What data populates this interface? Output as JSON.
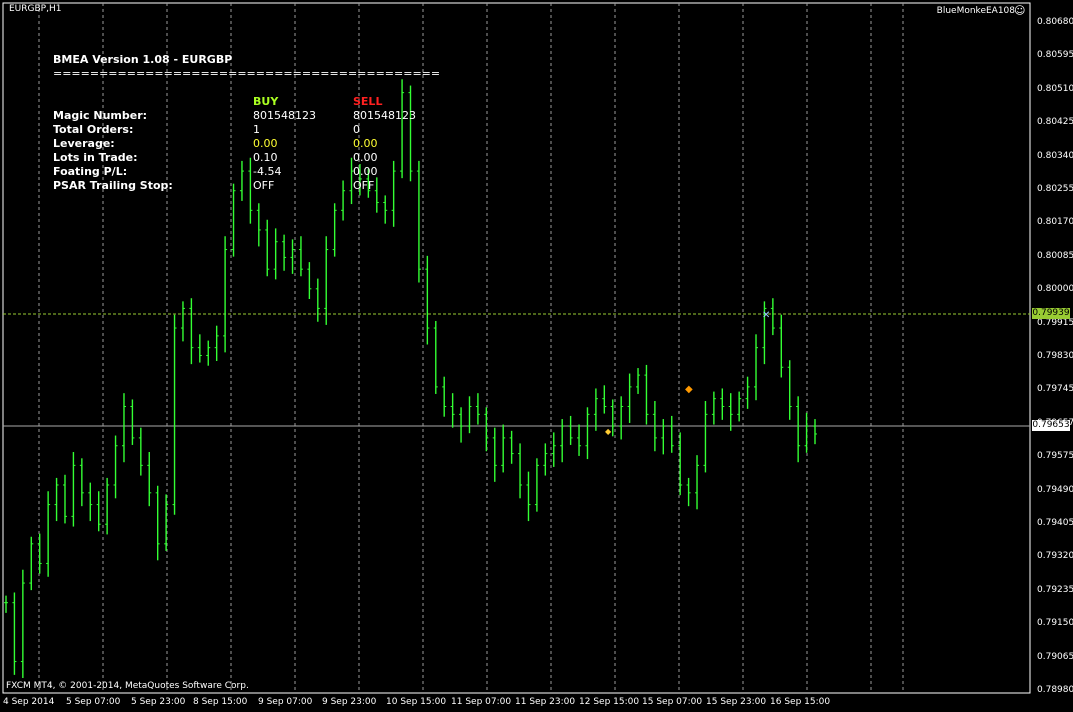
{
  "window": {
    "symbol": "EURGBP,H1",
    "ea_name": "BlueMonkeEA108",
    "copyright": "FXCM MT4, © 2001-2014, MetaQuotes Software Corp."
  },
  "colors": {
    "background": "#000000",
    "candle": "#33ff33",
    "grid": "#9a9a9a",
    "bid_line": "#aaaaaa",
    "ask_line": "#99cc33",
    "buy": "#aaff22",
    "sell": "#ff2020",
    "highlight": "#ffff33"
  },
  "hud": {
    "title": "BMEA Version 1.08 - EURGBP",
    "separator": "==========================================",
    "buy_header": "BUY",
    "sell_header": "SELL",
    "rows": [
      {
        "label": "Magic Number:",
        "buy": "801548123",
        "sell": "801548123"
      },
      {
        "label": "Total Orders:",
        "buy": "1",
        "sell": "0"
      },
      {
        "label": "Leverage:",
        "buy": "0.00",
        "sell": "0.00"
      },
      {
        "label": "Lots in Trade:",
        "buy": "0.10",
        "sell": "0.00"
      },
      {
        "label": "Foating P/L:",
        "buy": "-4.54",
        "sell": "0.00"
      },
      {
        "label": "PSAR Trailing Stop:",
        "buy": "OFF",
        "sell": "OFF"
      }
    ]
  },
  "price_axis": {
    "ticks": [
      "0.80680",
      "0.80595",
      "0.80510",
      "0.80425",
      "0.80340",
      "0.80255",
      "0.80170",
      "0.80085",
      "0.80000",
      "0.79915",
      "0.79830",
      "0.79745",
      "0.79657",
      "0.79575",
      "0.79490",
      "0.79405",
      "0.79320",
      "0.79235",
      "0.79150",
      "0.79065",
      "0.78980"
    ],
    "ask_price": "0.79939",
    "bid_price": "0.79653"
  },
  "time_axis": {
    "ticks": [
      "4 Sep 2014",
      "5 Sep 07:00",
      "5 Sep 23:00",
      "8 Sep 15:00",
      "9 Sep 07:00",
      "9 Sep 23:00",
      "10 Sep 15:00",
      "11 Sep 07:00",
      "11 Sep 23:00",
      "12 Sep 15:00",
      "15 Sep 07:00",
      "15 Sep 23:00",
      "16 Sep 15:00"
    ]
  },
  "chart_data": {
    "type": "bar",
    "title": "",
    "ylim": [
      0.7898,
      0.8068
    ],
    "closes": [
      0.792,
      0.7905,
      0.7925,
      0.7935,
      0.793,
      0.7945,
      0.795,
      0.7942,
      0.7955,
      0.7948,
      0.7945,
      0.794,
      0.795,
      0.796,
      0.797,
      0.7962,
      0.7955,
      0.7948,
      0.7935,
      0.7945,
      0.799,
      0.7995,
      0.7985,
      0.7983,
      0.7985,
      0.7988,
      0.801,
      0.8025,
      0.803,
      0.802,
      0.8015,
      0.8005,
      0.8012,
      0.8008,
      0.801,
      0.8005,
      0.8,
      0.7995,
      0.801,
      0.802,
      0.8025,
      0.803,
      0.8028,
      0.8025,
      0.8022,
      0.802,
      0.803,
      0.805,
      0.803,
      0.8005,
      0.799,
      0.7975,
      0.797,
      0.7968,
      0.7965,
      0.797,
      0.7968,
      0.7962,
      0.7955,
      0.7962,
      0.7958,
      0.795,
      0.7945,
      0.7955,
      0.7958,
      0.796,
      0.7965,
      0.7962,
      0.796,
      0.7968,
      0.7972,
      0.797,
      0.7965,
      0.797,
      0.7975,
      0.7978,
      0.7968,
      0.7962,
      0.7965,
      0.796,
      0.795,
      0.7948,
      0.7955,
      0.7968,
      0.7972,
      0.797,
      0.7968,
      0.7972,
      0.7975,
      0.7985,
      0.7995,
      0.799,
      0.798,
      0.797,
      0.796,
      0.7965,
      0.7963
    ]
  }
}
